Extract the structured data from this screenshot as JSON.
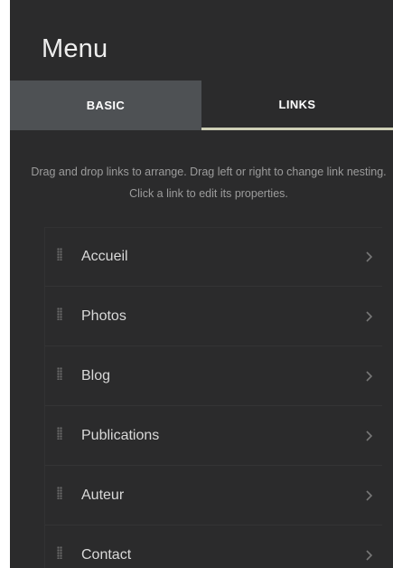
{
  "menu": {
    "title": "Menu"
  },
  "tabs": [
    {
      "label": "BASIC",
      "active": false
    },
    {
      "label": "LINKS",
      "active": true
    }
  ],
  "instructions": "Drag and drop links to arrange. Drag left or right to change link nesting. Click a link to edit its properties.",
  "links": [
    {
      "label": "Accueil"
    },
    {
      "label": "Photos"
    },
    {
      "label": "Blog"
    },
    {
      "label": "Publications"
    },
    {
      "label": "Auteur"
    },
    {
      "label": "Contact"
    }
  ],
  "icons": {
    "drag": "drag-handle-icon",
    "chevron": "chevron-right-icon"
  },
  "colors": {
    "panel_bg": "#2b2b2c",
    "tab_inactive_bg": "#4e5154",
    "tab_active_underline": "#cfd0b6",
    "text": "#d9d9d9",
    "muted_text": "#9c9c9c"
  }
}
